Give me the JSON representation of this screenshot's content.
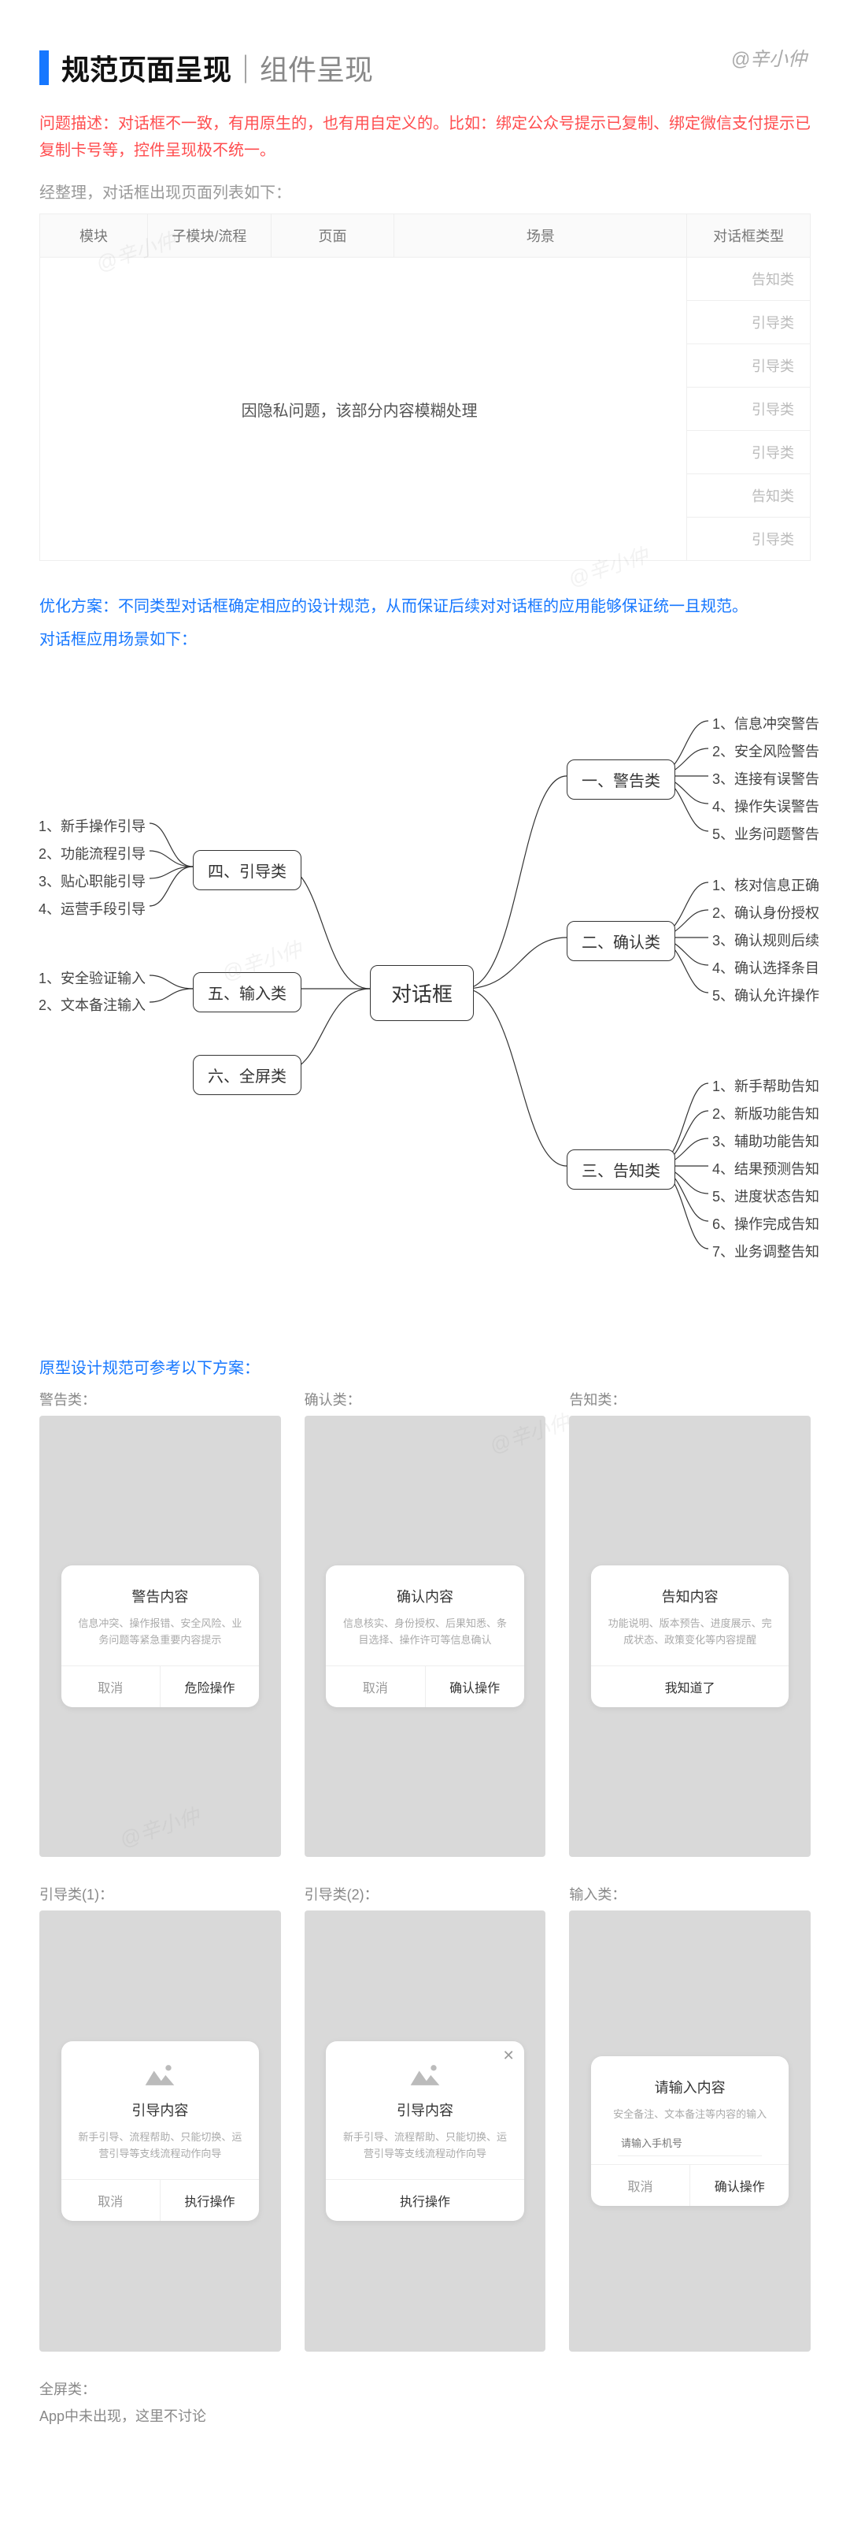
{
  "watermark": "@辛小仲",
  "header": {
    "title": "规范页面呈现",
    "subtitle": "｜组件呈现"
  },
  "problem": "问题描述：对话框不一致，有用原生的，也有用自定义的。比如：绑定公众号提示已复制、绑定微信支付提示已复制卡号等，控件呈现极不统一。",
  "after_sort": "经整理，对话框出现页面列表如下：",
  "table": {
    "headers": [
      "模块",
      "子模块/流程",
      "页面",
      "场景",
      "对话框类型"
    ],
    "blur_text": "因隐私问题，该部分内容模糊处理",
    "types": [
      "告知类",
      "引导类",
      "引导类",
      "引导类",
      "引导类",
      "告知类",
      "引导类"
    ]
  },
  "opt_plan": "优化方案：不同类型对话框确定相应的设计规范，从而保证后续对对话框的应用能够保证统一且规范。",
  "scene_label": "对话框应用场景如下：",
  "mindmap": {
    "center": "对话框",
    "right": [
      {
        "label": "一、警告类",
        "children": [
          "1、信息冲突警告",
          "2、安全风险警告",
          "3、连接有误警告",
          "4、操作失误警告",
          "5、业务问题警告"
        ]
      },
      {
        "label": "二、确认类",
        "children": [
          "1、核对信息正确",
          "2、确认身份授权",
          "3、确认规则后续",
          "4、确认选择条目",
          "5、确认允许操作"
        ]
      },
      {
        "label": "三、告知类",
        "children": [
          "1、新手帮助告知",
          "2、新版功能告知",
          "3、辅助功能告知",
          "4、结果预测告知",
          "5、进度状态告知",
          "6、操作完成告知",
          "7、业务调整告知"
        ]
      }
    ],
    "left": [
      {
        "label": "四、引导类",
        "children": [
          "1、新手操作引导",
          "2、功能流程引导",
          "3、贴心职能引导",
          "4、运营手段引导"
        ]
      },
      {
        "label": "五、输入类",
        "children": [
          "1、安全验证输入",
          "2、文本备注输入"
        ]
      },
      {
        "label": "六、全屏类",
        "children": []
      }
    ]
  },
  "proto_label": "原型设计规范可参考以下方案：",
  "prototypes": {
    "row1": [
      {
        "cat": "警告类：",
        "title": "警告内容",
        "desc": "信息冲突、操作报错、安全风险、业务问题等紧急重要内容提示",
        "btns": [
          "取消",
          "危险操作"
        ]
      },
      {
        "cat": "确认类：",
        "title": "确认内容",
        "desc": "信息核实、身份授权、后果知悉、条目选择、操作许可等信息确认",
        "btns": [
          "取消",
          "确认操作"
        ]
      },
      {
        "cat": "告知类：",
        "title": "告知内容",
        "desc": "功能说明、版本预告、进度展示、完成状态、政策变化等内容提醒",
        "btns": [
          "我知道了"
        ]
      }
    ],
    "row2": [
      {
        "cat": "引导类(1)：",
        "img": true,
        "title": "引导内容",
        "desc": "新手引导、流程帮助、只能切换、运营引导等支线流程动作向导",
        "btns": [
          "取消",
          "执行操作"
        ]
      },
      {
        "cat": "引导类(2)：",
        "img": true,
        "close": true,
        "title": "引导内容",
        "desc": "新手引导、流程帮助、只能切换、运营引导等支线流程动作向导",
        "btns": [
          "执行操作"
        ]
      },
      {
        "cat": "输入类：",
        "title": "请输入内容",
        "desc": "安全备注、文本备注等内容的输入",
        "input": "请输入手机号",
        "btns": [
          "取消",
          "确认操作"
        ]
      }
    ],
    "fullscreen": {
      "cat": "全屏类：",
      "note": "App中未出现，这里不讨论"
    }
  }
}
